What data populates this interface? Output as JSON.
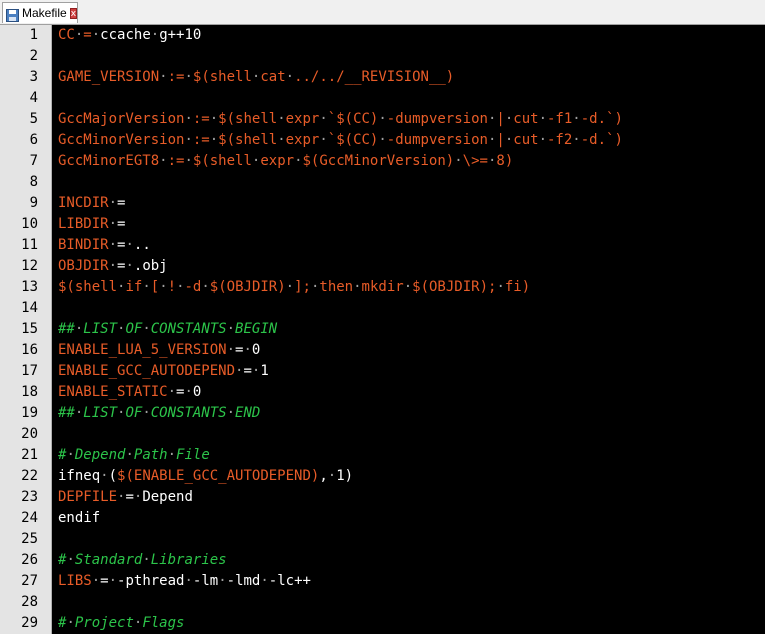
{
  "tab": {
    "label": "Makefile",
    "close_glyph": "x",
    "icon": "save-file-icon"
  },
  "colors": {
    "keyword": "#e85c28",
    "comment": "#2cc44a",
    "text": "#ffffff",
    "background": "#000000"
  },
  "lines": [
    {
      "n": "1",
      "segs": [
        [
          "k",
          "CC"
        ],
        [
          "d",
          "·"
        ],
        [
          "k",
          "="
        ],
        [
          "d",
          "·"
        ],
        [
          "w",
          "ccache"
        ],
        [
          "d",
          "·"
        ],
        [
          "w",
          "g++10"
        ]
      ]
    },
    {
      "n": "2",
      "segs": []
    },
    {
      "n": "3",
      "segs": [
        [
          "k",
          "GAME_VERSION"
        ],
        [
          "d",
          "·"
        ],
        [
          "k",
          ":="
        ],
        [
          "d",
          "·"
        ],
        [
          "k",
          "$(shell"
        ],
        [
          "d",
          "·"
        ],
        [
          "k",
          "cat"
        ],
        [
          "d",
          "·"
        ],
        [
          "k",
          "../../__REVISION__)"
        ]
      ]
    },
    {
      "n": "4",
      "segs": []
    },
    {
      "n": "5",
      "segs": [
        [
          "k",
          "GccMajorVersion"
        ],
        [
          "d",
          "·"
        ],
        [
          "k",
          ":="
        ],
        [
          "d",
          "·"
        ],
        [
          "k",
          "$(shell"
        ],
        [
          "d",
          "·"
        ],
        [
          "k",
          "expr"
        ],
        [
          "d",
          "·"
        ],
        [
          "k",
          "`$(CC)"
        ],
        [
          "d",
          "·"
        ],
        [
          "k",
          "-dumpversion"
        ],
        [
          "d",
          "·"
        ],
        [
          "k",
          "|"
        ],
        [
          "d",
          "·"
        ],
        [
          "k",
          "cut"
        ],
        [
          "d",
          "·"
        ],
        [
          "k",
          "-f1"
        ],
        [
          "d",
          "·"
        ],
        [
          "k",
          "-d.`)"
        ]
      ]
    },
    {
      "n": "6",
      "segs": [
        [
          "k",
          "GccMinorVersion"
        ],
        [
          "d",
          "·"
        ],
        [
          "k",
          ":="
        ],
        [
          "d",
          "·"
        ],
        [
          "k",
          "$(shell"
        ],
        [
          "d",
          "·"
        ],
        [
          "k",
          "expr"
        ],
        [
          "d",
          "·"
        ],
        [
          "k",
          "`$(CC)"
        ],
        [
          "d",
          "·"
        ],
        [
          "k",
          "-dumpversion"
        ],
        [
          "d",
          "·"
        ],
        [
          "k",
          "|"
        ],
        [
          "d",
          "·"
        ],
        [
          "k",
          "cut"
        ],
        [
          "d",
          "·"
        ],
        [
          "k",
          "-f2"
        ],
        [
          "d",
          "·"
        ],
        [
          "k",
          "-d.`)"
        ]
      ]
    },
    {
      "n": "7",
      "segs": [
        [
          "k",
          "GccMinorEGT8"
        ],
        [
          "d",
          "·"
        ],
        [
          "k",
          ":="
        ],
        [
          "d",
          "·"
        ],
        [
          "k",
          "$(shell"
        ],
        [
          "d",
          "·"
        ],
        [
          "k",
          "expr"
        ],
        [
          "d",
          "·"
        ],
        [
          "k",
          "$(GccMinorVersion)"
        ],
        [
          "d",
          "·"
        ],
        [
          "k",
          "\\>="
        ],
        [
          "d",
          "·"
        ],
        [
          "k",
          "8)"
        ]
      ]
    },
    {
      "n": "8",
      "segs": []
    },
    {
      "n": "9",
      "segs": [
        [
          "k",
          "INCDIR"
        ],
        [
          "d",
          "·"
        ],
        [
          "w",
          "="
        ]
      ]
    },
    {
      "n": "10",
      "segs": [
        [
          "k",
          "LIBDIR"
        ],
        [
          "d",
          "·"
        ],
        [
          "w",
          "="
        ]
      ]
    },
    {
      "n": "11",
      "segs": [
        [
          "k",
          "BINDIR"
        ],
        [
          "d",
          "·"
        ],
        [
          "w",
          "="
        ],
        [
          "d",
          "·"
        ],
        [
          "w",
          ".."
        ]
      ]
    },
    {
      "n": "12",
      "segs": [
        [
          "k",
          "OBJDIR"
        ],
        [
          "d",
          "·"
        ],
        [
          "w",
          "="
        ],
        [
          "d",
          "·"
        ],
        [
          "w",
          ".obj"
        ]
      ]
    },
    {
      "n": "13",
      "segs": [
        [
          "k",
          "$(shell"
        ],
        [
          "d",
          "·"
        ],
        [
          "k",
          "if"
        ],
        [
          "d",
          "·"
        ],
        [
          "k",
          "["
        ],
        [
          "d",
          "·"
        ],
        [
          "k",
          "!"
        ],
        [
          "d",
          "·"
        ],
        [
          "k",
          "-d"
        ],
        [
          "d",
          "·"
        ],
        [
          "k",
          "$(OBJDIR)"
        ],
        [
          "d",
          "·"
        ],
        [
          "k",
          "];"
        ],
        [
          "d",
          "·"
        ],
        [
          "k",
          "then"
        ],
        [
          "d",
          "·"
        ],
        [
          "k",
          "mkdir"
        ],
        [
          "d",
          "·"
        ],
        [
          "k",
          "$(OBJDIR);"
        ],
        [
          "d",
          "·"
        ],
        [
          "k",
          "fi)"
        ]
      ]
    },
    {
      "n": "14",
      "segs": []
    },
    {
      "n": "15",
      "segs": [
        [
          "c",
          "##"
        ],
        [
          "d",
          "·"
        ],
        [
          "c",
          "LIST"
        ],
        [
          "d",
          "·"
        ],
        [
          "c",
          "OF"
        ],
        [
          "d",
          "·"
        ],
        [
          "c",
          "CONSTANTS"
        ],
        [
          "d",
          "·"
        ],
        [
          "c",
          "BEGIN"
        ]
      ]
    },
    {
      "n": "16",
      "segs": [
        [
          "k",
          "ENABLE_LUA_5_VERSION"
        ],
        [
          "d",
          "·"
        ],
        [
          "w",
          "="
        ],
        [
          "d",
          "·"
        ],
        [
          "w",
          "0"
        ]
      ]
    },
    {
      "n": "17",
      "segs": [
        [
          "k",
          "ENABLE_GCC_AUTODEPEND"
        ],
        [
          "d",
          "·"
        ],
        [
          "w",
          "="
        ],
        [
          "d",
          "·"
        ],
        [
          "w",
          "1"
        ]
      ]
    },
    {
      "n": "18",
      "segs": [
        [
          "k",
          "ENABLE_STATIC"
        ],
        [
          "d",
          "·"
        ],
        [
          "w",
          "="
        ],
        [
          "d",
          "·"
        ],
        [
          "w",
          "0"
        ]
      ]
    },
    {
      "n": "19",
      "segs": [
        [
          "c",
          "##"
        ],
        [
          "d",
          "·"
        ],
        [
          "c",
          "LIST"
        ],
        [
          "d",
          "·"
        ],
        [
          "c",
          "OF"
        ],
        [
          "d",
          "·"
        ],
        [
          "c",
          "CONSTANTS"
        ],
        [
          "d",
          "·"
        ],
        [
          "c",
          "END"
        ]
      ]
    },
    {
      "n": "20",
      "segs": []
    },
    {
      "n": "21",
      "segs": [
        [
          "c",
          "#"
        ],
        [
          "d",
          "·"
        ],
        [
          "c",
          "Depend"
        ],
        [
          "d",
          "·"
        ],
        [
          "c",
          "Path"
        ],
        [
          "d",
          "·"
        ],
        [
          "c",
          "File"
        ]
      ]
    },
    {
      "n": "22",
      "segs": [
        [
          "w",
          "ifneq"
        ],
        [
          "d",
          "·"
        ],
        [
          "w",
          "("
        ],
        [
          "k",
          "$(ENABLE_GCC_AUTODEPEND)"
        ],
        [
          "w",
          ","
        ],
        [
          "d",
          "·"
        ],
        [
          "w",
          "1)"
        ]
      ]
    },
    {
      "n": "23",
      "segs": [
        [
          "k",
          "DEPFILE"
        ],
        [
          "d",
          "·"
        ],
        [
          "w",
          "="
        ],
        [
          "d",
          "·"
        ],
        [
          "w",
          "Depend"
        ]
      ]
    },
    {
      "n": "24",
      "segs": [
        [
          "w",
          "endif"
        ]
      ]
    },
    {
      "n": "25",
      "segs": []
    },
    {
      "n": "26",
      "segs": [
        [
          "c",
          "#"
        ],
        [
          "d",
          "·"
        ],
        [
          "c",
          "Standard"
        ],
        [
          "d",
          "·"
        ],
        [
          "c",
          "Libraries"
        ]
      ]
    },
    {
      "n": "27",
      "segs": [
        [
          "k",
          "LIBS"
        ],
        [
          "d",
          "·"
        ],
        [
          "w",
          "="
        ],
        [
          "d",
          "·"
        ],
        [
          "w",
          "-pthread"
        ],
        [
          "d",
          "·"
        ],
        [
          "w",
          "-lm"
        ],
        [
          "d",
          "·"
        ],
        [
          "w",
          "-lmd"
        ],
        [
          "d",
          "·"
        ],
        [
          "w",
          "-lc++"
        ]
      ]
    },
    {
      "n": "28",
      "segs": []
    },
    {
      "n": "29",
      "segs": [
        [
          "c",
          "#"
        ],
        [
          "d",
          "·"
        ],
        [
          "c",
          "Project"
        ],
        [
          "d",
          "·"
        ],
        [
          "c",
          "Flags"
        ]
      ]
    }
  ]
}
